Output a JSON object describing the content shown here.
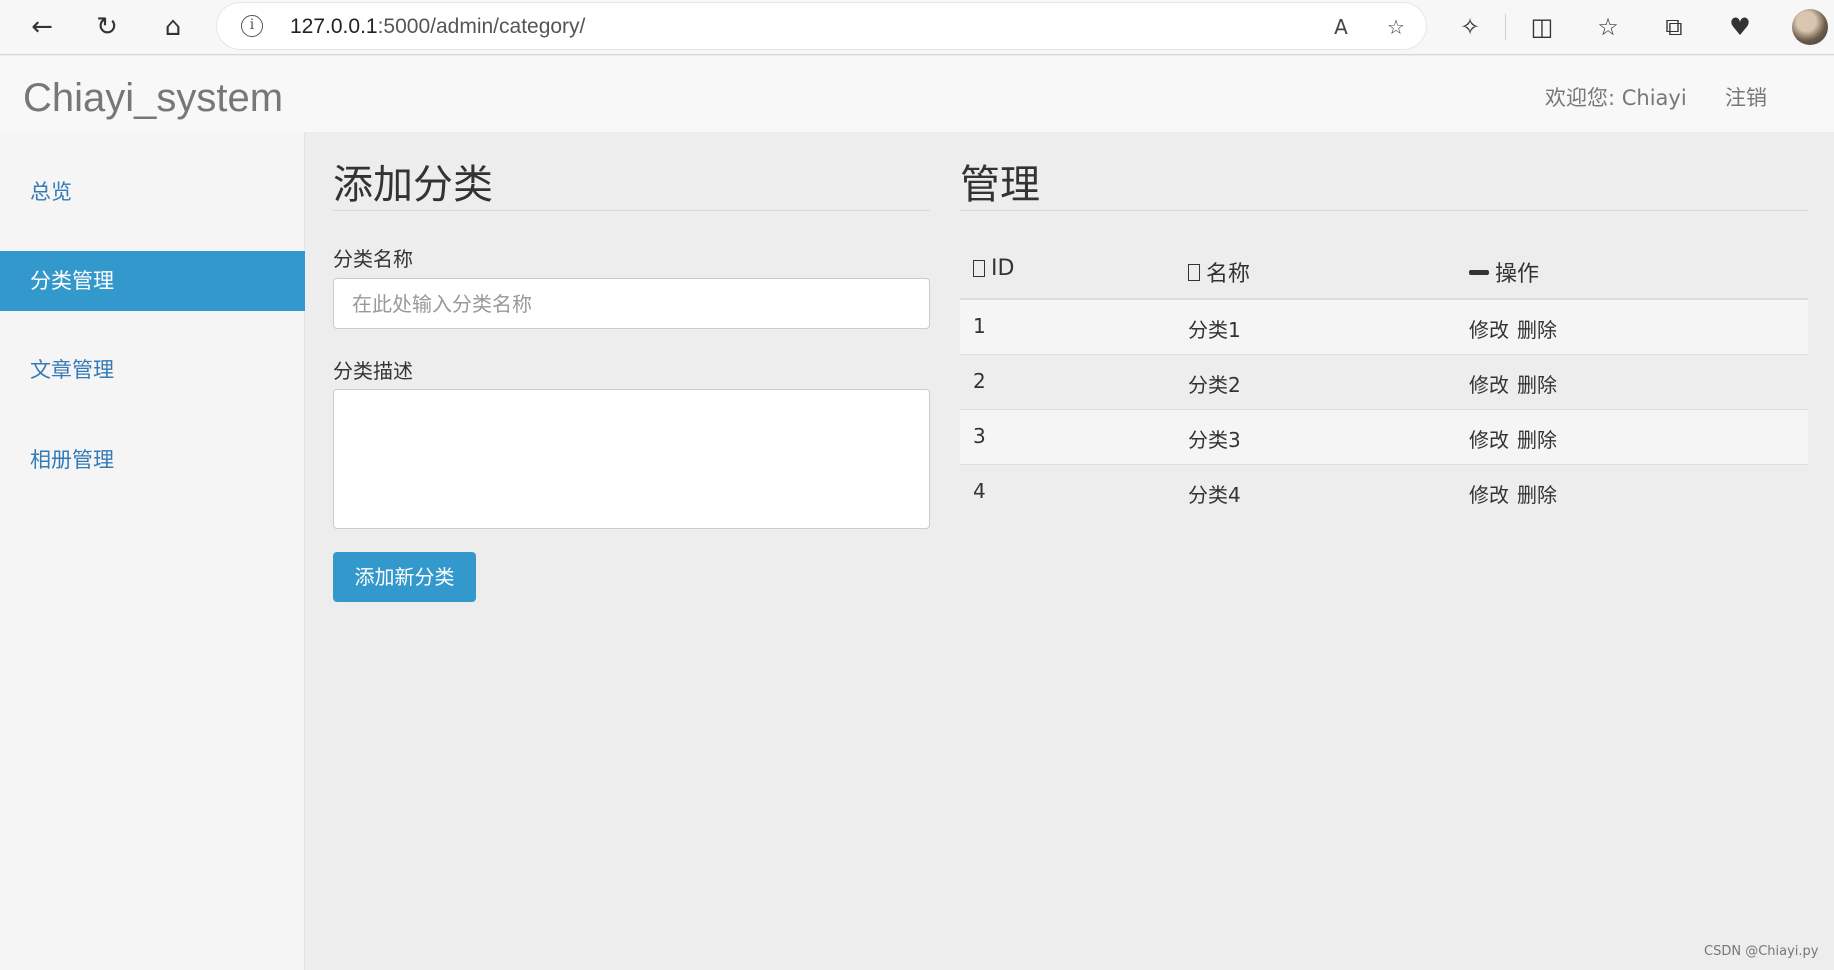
{
  "browser": {
    "url_host": "127.0.0.1",
    "url_path": ":5000/admin/category/",
    "icons": {
      "back": "←",
      "reload": "↻",
      "home": "⌂",
      "info": "i",
      "read_aloud": "A",
      "favorite_add": "☆",
      "extensions": "✧",
      "split_screen": "◫",
      "favorites": "☆",
      "collections": "⧉",
      "health": "♥"
    }
  },
  "header": {
    "brand": "Chiayi_system",
    "welcome": "欢迎您: Chiayi",
    "logout": "注销"
  },
  "sidebar": {
    "items": [
      {
        "label": "总览",
        "active": false
      },
      {
        "label": "分类管理",
        "active": true
      },
      {
        "label": "文章管理",
        "active": false
      },
      {
        "label": "相册管理",
        "active": false
      }
    ]
  },
  "form": {
    "title": "添加分类",
    "name_label": "分类名称",
    "name_placeholder": "在此处输入分类名称",
    "name_value": "",
    "desc_label": "分类描述",
    "desc_value": "",
    "submit_label": "添加新分类"
  },
  "manage": {
    "title": "管理",
    "columns": [
      "ID",
      "名称",
      "操作"
    ],
    "rows": [
      {
        "id": "1",
        "name": "分类1",
        "edit": "修改",
        "delete": "删除"
      },
      {
        "id": "2",
        "name": "分类2",
        "edit": "修改",
        "delete": "删除"
      },
      {
        "id": "3",
        "name": "分类3",
        "edit": "修改",
        "delete": "删除"
      },
      {
        "id": "4",
        "name": "分类4",
        "edit": "修改",
        "delete": "删除"
      }
    ]
  },
  "watermark": "CSDN @Chiayi.py",
  "colors": {
    "accent": "#3399cc",
    "brand_text": "#777777",
    "background": "#ededed"
  }
}
